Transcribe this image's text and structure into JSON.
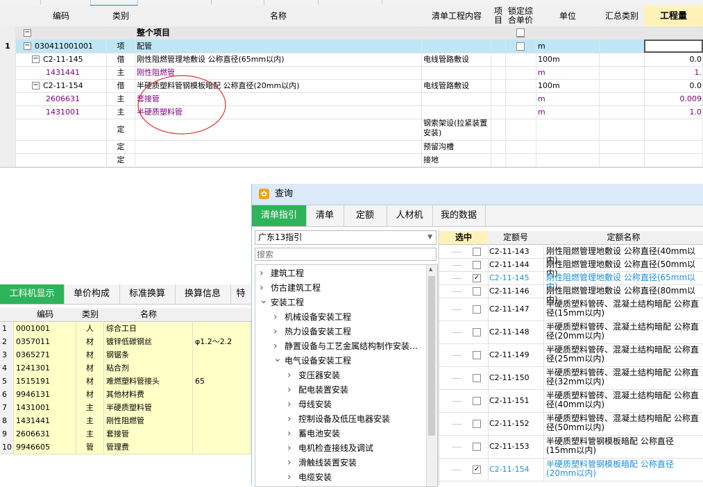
{
  "main_grid": {
    "columns": [
      "编码",
      "类别",
      "名称",
      "清单工程内容",
      "项目",
      "锁定综合单价",
      "单位",
      "汇总类别",
      "工程量"
    ],
    "rows": [
      {
        "num": "",
        "code": "",
        "type": "",
        "name": "整个项目",
        "content": "",
        "unit": "",
        "qty": "",
        "lock_checkbox": true
      },
      {
        "num": "1",
        "code": "030411001001",
        "type": "项",
        "name": "配管",
        "content": "",
        "unit": "m",
        "qty": "",
        "lock_checkbox": true
      },
      {
        "num": "",
        "code": "C2-11-145",
        "type": "借",
        "name": "刚性阻燃管理地敷设 公称直径(65mm以内)",
        "content": "电线管路敷设",
        "unit": "100m",
        "qty": "0.0"
      },
      {
        "num": "",
        "code": "1431441",
        "type": "主",
        "name": "刚性阻燃管",
        "content": "",
        "unit": "m",
        "qty": "1."
      },
      {
        "num": "",
        "code": "C2-11-154",
        "type": "借",
        "name": "半硬质塑料管钢模板暗配 公称直径(20mm以内)",
        "content": "电线管路敷设",
        "unit": "100m",
        "qty": "0.0"
      },
      {
        "num": "",
        "code": "2606631",
        "type": "主",
        "name": "套接管",
        "content": "",
        "unit": "m",
        "qty": "0.009"
      },
      {
        "num": "",
        "code": "1431001",
        "type": "主",
        "name": "半硬质塑料管",
        "content": "",
        "unit": "m",
        "qty": "1.0"
      },
      {
        "num": "",
        "code": "",
        "type": "定",
        "name": "",
        "content": "钢索架设(拉紧装置安装)",
        "unit": "",
        "qty": ""
      },
      {
        "num": "",
        "code": "",
        "type": "定",
        "name": "",
        "content": "预留沟槽",
        "unit": "",
        "qty": ""
      },
      {
        "num": "",
        "code": "",
        "type": "定",
        "name": "",
        "content": "接地",
        "unit": "",
        "qty": ""
      }
    ]
  },
  "bottom_left": {
    "tabs": [
      "工料机显示",
      "单价构成",
      "标准换算",
      "换算信息",
      "特"
    ],
    "columns": [
      "编码",
      "类别",
      "名称"
    ],
    "rows": [
      {
        "num": "1",
        "code": "0001001",
        "type": "人",
        "name": "综合工日",
        "spec": ""
      },
      {
        "num": "2",
        "code": "0357011",
        "type": "材",
        "name": "镀锌低碳钢丝",
        "spec": "φ1.2～2.2"
      },
      {
        "num": "3",
        "code": "0365271",
        "type": "材",
        "name": "钢锯条",
        "spec": ""
      },
      {
        "num": "4",
        "code": "1241301",
        "type": "材",
        "name": "粘合剂",
        "spec": ""
      },
      {
        "num": "5",
        "code": "1515191",
        "type": "材",
        "name": "难燃塑料管接头",
        "spec": "65"
      },
      {
        "num": "6",
        "code": "9946131",
        "type": "材",
        "name": "其他材料费",
        "spec": ""
      },
      {
        "num": "7",
        "code": "1431001",
        "type": "主",
        "name": "半硬质塑料管",
        "spec": ""
      },
      {
        "num": "8",
        "code": "1431441",
        "type": "主",
        "name": "刚性阻燃管",
        "spec": ""
      },
      {
        "num": "9",
        "code": "2606631",
        "type": "主",
        "name": "套接管",
        "spec": ""
      },
      {
        "num": "10",
        "code": "9946605",
        "type": "管",
        "name": "管理费",
        "spec": ""
      }
    ]
  },
  "dialog": {
    "title": "查询",
    "tabs": [
      "清单指引",
      "清单",
      "定额",
      "人材机",
      "我的数据"
    ],
    "dropdown_value": "广东13指引",
    "search_placeholder": "搜索",
    "tree": [
      {
        "label": "建筑工程",
        "level": 0,
        "expanded": false
      },
      {
        "label": "仿古建筑工程",
        "level": 0,
        "expanded": false
      },
      {
        "label": "安装工程",
        "level": 0,
        "expanded": true
      },
      {
        "label": "机械设备安装工程",
        "level": 1,
        "expanded": false
      },
      {
        "label": "热力设备安装工程",
        "level": 1,
        "expanded": false
      },
      {
        "label": "静置设备与工艺金属结构制作安装…",
        "level": 1,
        "expanded": false
      },
      {
        "label": "电气设备安装工程",
        "level": 1,
        "expanded": true
      },
      {
        "label": "变压器安装",
        "level": 2,
        "expanded": false
      },
      {
        "label": "配电装置安装",
        "level": 2,
        "expanded": false
      },
      {
        "label": "母线安装",
        "level": 2,
        "expanded": false
      },
      {
        "label": "控制设备及低压电器安装",
        "level": 2,
        "expanded": false
      },
      {
        "label": "蓄电池安装",
        "level": 2,
        "expanded": false
      },
      {
        "label": "电机检查接线及调试",
        "level": 2,
        "expanded": false
      },
      {
        "label": "滑触线装置安装",
        "level": 2,
        "expanded": false
      },
      {
        "label": "电缆安装",
        "level": 2,
        "expanded": false
      }
    ],
    "result_columns": [
      "选中",
      "定额号",
      "定额名称"
    ],
    "results": [
      {
        "code": "C2-11-143",
        "name": "刚性阻燃管理地敷设 公称直径(40mm以内)",
        "checked": false,
        "highlight": false
      },
      {
        "code": "C2-11-144",
        "name": "刚性阻燃管理地敷设 公称直径(50mm以内)",
        "checked": false,
        "highlight": false
      },
      {
        "code": "C2-11-145",
        "name": "刚性阻燃管理地敷设 公称直径(65mm以内)",
        "checked": true,
        "highlight": true
      },
      {
        "code": "C2-11-146",
        "name": "刚性阻燃管理地敷设 公称直径(80mm以内)",
        "checked": false,
        "highlight": false
      },
      {
        "code": "C2-11-147",
        "name": "半硬质塑料管砖、混凝土结构暗配 公称直径(15mm以内)",
        "checked": false,
        "highlight": false
      },
      {
        "code": "C2-11-148",
        "name": "半硬质塑料管砖、混凝土结构暗配 公称直径(20mm以内)",
        "checked": false,
        "highlight": false
      },
      {
        "code": "C2-11-149",
        "name": "半硬质塑料管砖、混凝土结构暗配 公称直径(25mm以内)",
        "checked": false,
        "highlight": false
      },
      {
        "code": "C2-11-150",
        "name": "半硬质塑料管砖、混凝土结构暗配 公称直径(32mm以内)",
        "checked": false,
        "highlight": false
      },
      {
        "code": "C2-11-151",
        "name": "半硬质塑料管砖、混凝土结构暗配 公称直径(40mm以内)",
        "checked": false,
        "highlight": false
      },
      {
        "code": "C2-11-152",
        "name": "半硬质塑料管砖、混凝土结构暗配 公称直径(50mm以内)",
        "checked": false,
        "highlight": false
      },
      {
        "code": "C2-11-153",
        "name": "半硬质塑料管钢模板暗配 公称直径(15mm以内)",
        "checked": false,
        "highlight": false
      },
      {
        "code": "C2-11-154",
        "name": "半硬质塑料管钢模板暗配 公称直径(20mm以内)",
        "checked": true,
        "highlight": true
      }
    ]
  },
  "colors": {
    "accent_green": "#2eb35a",
    "selected_row": "#bfe6f5",
    "yellow_row": "#ffffc8",
    "highlight_blue": "#1e8fd6",
    "purple_text": "#800080",
    "annotation_red": "#e0302f"
  }
}
